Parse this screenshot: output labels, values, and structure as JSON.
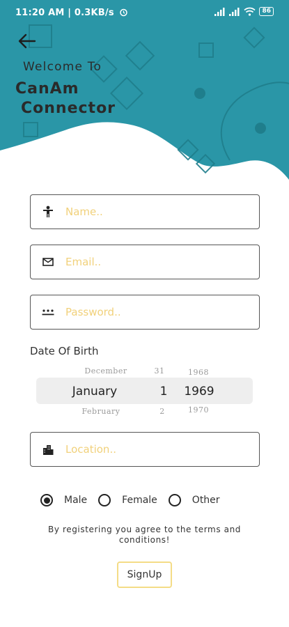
{
  "status_bar": {
    "left_text": "11:20 AM | 0.3KB/s",
    "battery": "86"
  },
  "header": {
    "welcome": "Welcome To",
    "app_name_line1": "CanAm",
    "app_name_line2": "Connector"
  },
  "colors": {
    "header_bg": "#2a96a7",
    "placeholder": "#f1d17b",
    "signup_border": "#f4dc86"
  },
  "icons": {
    "back": "arrow-left-icon",
    "name": "person-icon",
    "email": "mail-icon",
    "password": "password-dots-icon",
    "location": "city-icon"
  },
  "form": {
    "name_placeholder": "Name..",
    "email_placeholder": "Email..",
    "password_placeholder": "Password..",
    "location_placeholder": "Location..",
    "dob_label": "Date Of Birth"
  },
  "date_picker": {
    "prev": {
      "month": "December",
      "day": "31",
      "year": "1968"
    },
    "selected": {
      "month": "January",
      "day": "1",
      "year": "1969"
    },
    "next": {
      "month": "February",
      "day": "2",
      "year": "1970"
    }
  },
  "gender": {
    "options": [
      "Male",
      "Female",
      "Other"
    ],
    "selected": "Male"
  },
  "terms_text": "By registering you agree to the terms and conditions!",
  "signup_label": "SignUp"
}
